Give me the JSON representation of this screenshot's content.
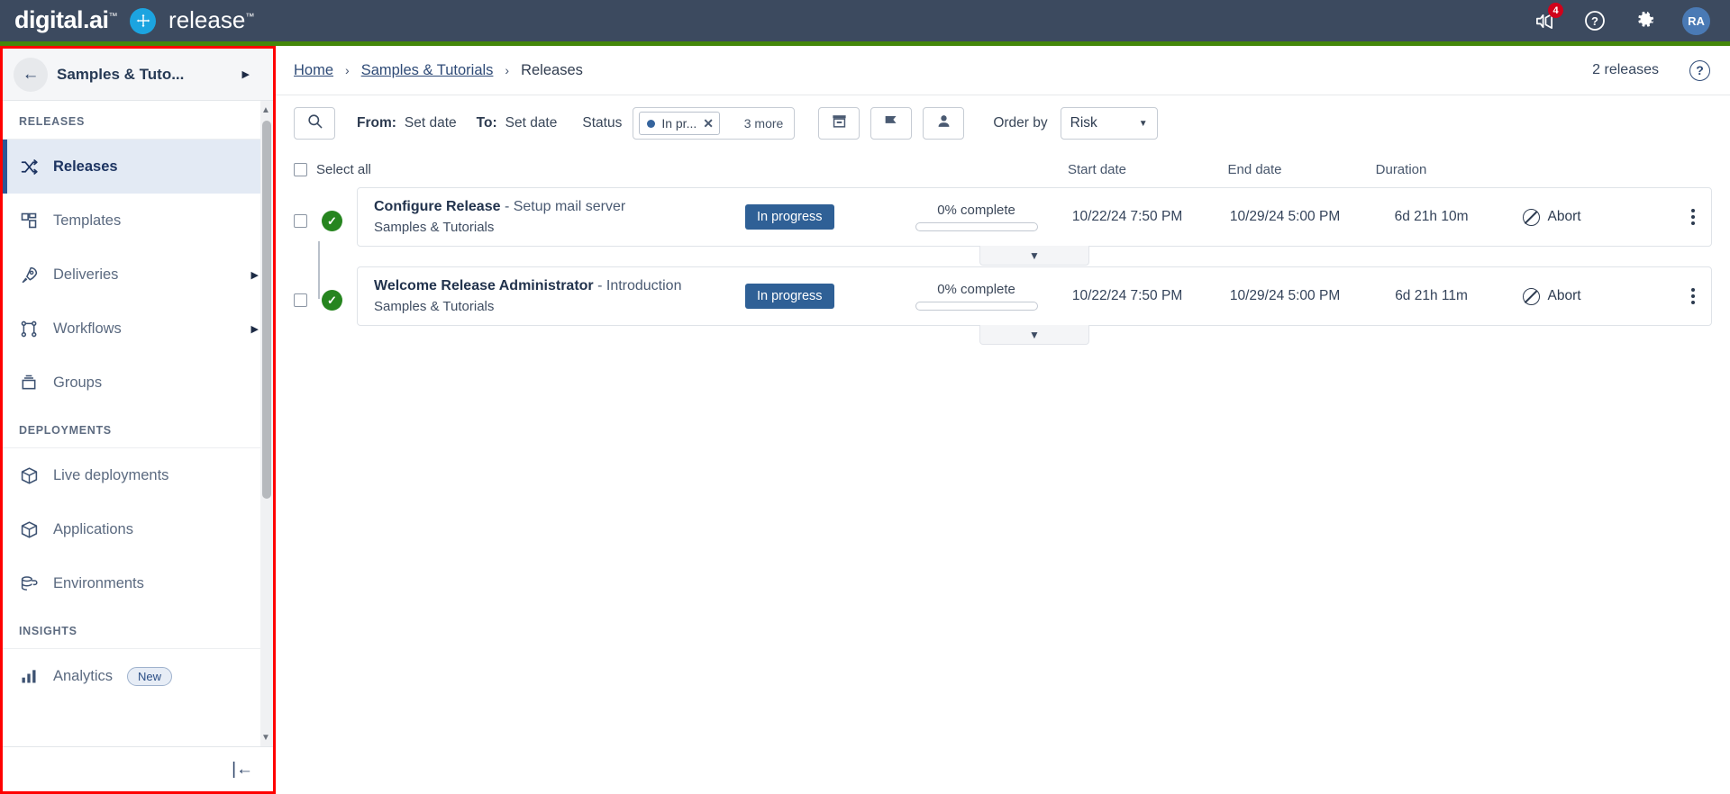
{
  "header": {
    "brand_primary": "digital.ai",
    "brand_secondary": "release",
    "trademark": "™",
    "notification_badge": "4",
    "avatar_initials": "RA",
    "icons": [
      "megaphone-icon",
      "help-icon",
      "gear-icon"
    ]
  },
  "sidebar": {
    "context_title": "Samples & Tuto...",
    "back_arrow": "←",
    "caret": "▶",
    "collapse_icon": "|←",
    "sections": [
      {
        "label": "RELEASES",
        "items": [
          {
            "label": "Releases",
            "icon": "shuffle-icon",
            "active": true,
            "has_submenu": false
          },
          {
            "label": "Templates",
            "icon": "template-icon",
            "active": false,
            "has_submenu": false
          },
          {
            "label": "Deliveries",
            "icon": "rocket-icon",
            "active": false,
            "has_submenu": true
          },
          {
            "label": "Workflows",
            "icon": "workflow-icon",
            "active": false,
            "has_submenu": true
          },
          {
            "label": "Groups",
            "icon": "groups-icon",
            "active": false,
            "has_submenu": false
          }
        ]
      },
      {
        "label": "DEPLOYMENTS",
        "items": [
          {
            "label": "Live deployments",
            "icon": "cube-icon",
            "active": false,
            "has_submenu": false
          },
          {
            "label": "Applications",
            "icon": "cube-icon",
            "active": false,
            "has_submenu": false
          },
          {
            "label": "Environments",
            "icon": "environment-icon",
            "active": false,
            "has_submenu": false
          }
        ]
      },
      {
        "label": "INSIGHTS",
        "items": [
          {
            "label": "Analytics",
            "icon": "bar-chart-icon",
            "active": false,
            "has_submenu": false,
            "badge": "New"
          }
        ]
      }
    ]
  },
  "breadcrumb": {
    "items": [
      "Home",
      "Samples & Tutorials",
      "Releases"
    ],
    "separator": "›",
    "release_count": "2 releases",
    "help_icon": "?"
  },
  "filters": {
    "search_icon": "search-icon",
    "from_label": "From:",
    "from_value": "Set date",
    "to_label": "To:",
    "to_value": "Set date",
    "status_label": "Status",
    "status_chip": "In pr...",
    "status_chip_remove": "✕",
    "status_more": "3 more",
    "archive_icon": "archive-icon",
    "flag_icon": "flag-icon",
    "person_icon": "person-icon",
    "orderby_label": "Order by",
    "orderby_value": "Risk"
  },
  "table": {
    "select_all": "Select all",
    "columns": [
      "Start date",
      "End date",
      "Duration"
    ],
    "rows": [
      {
        "title": "Configure Release",
        "subtitle": "- Setup mail server",
        "folder": "Samples & Tutorials",
        "status": "In progress",
        "progress_text": "0% complete",
        "progress_pct": 0,
        "start_date": "10/22/24 7:50 PM",
        "end_date": "10/29/24 5:00 PM",
        "duration": "6d 21h 10m",
        "action": "Abort"
      },
      {
        "title": "Welcome Release Administrator",
        "subtitle": "- Introduction",
        "folder": "Samples & Tutorials",
        "status": "In progress",
        "progress_text": "0% complete",
        "progress_pct": 0,
        "start_date": "10/22/24 7:50 PM",
        "end_date": "10/29/24 5:00 PM",
        "duration": "6d 21h 11m",
        "action": "Abort"
      }
    ]
  },
  "colors": {
    "header_bg": "#3c4a5f",
    "accent_green": "#44870a",
    "brand_blue": "#1ca4e0",
    "status_blue": "#2f6096",
    "success_green": "#26851f",
    "highlight_red": "#ff0000"
  }
}
